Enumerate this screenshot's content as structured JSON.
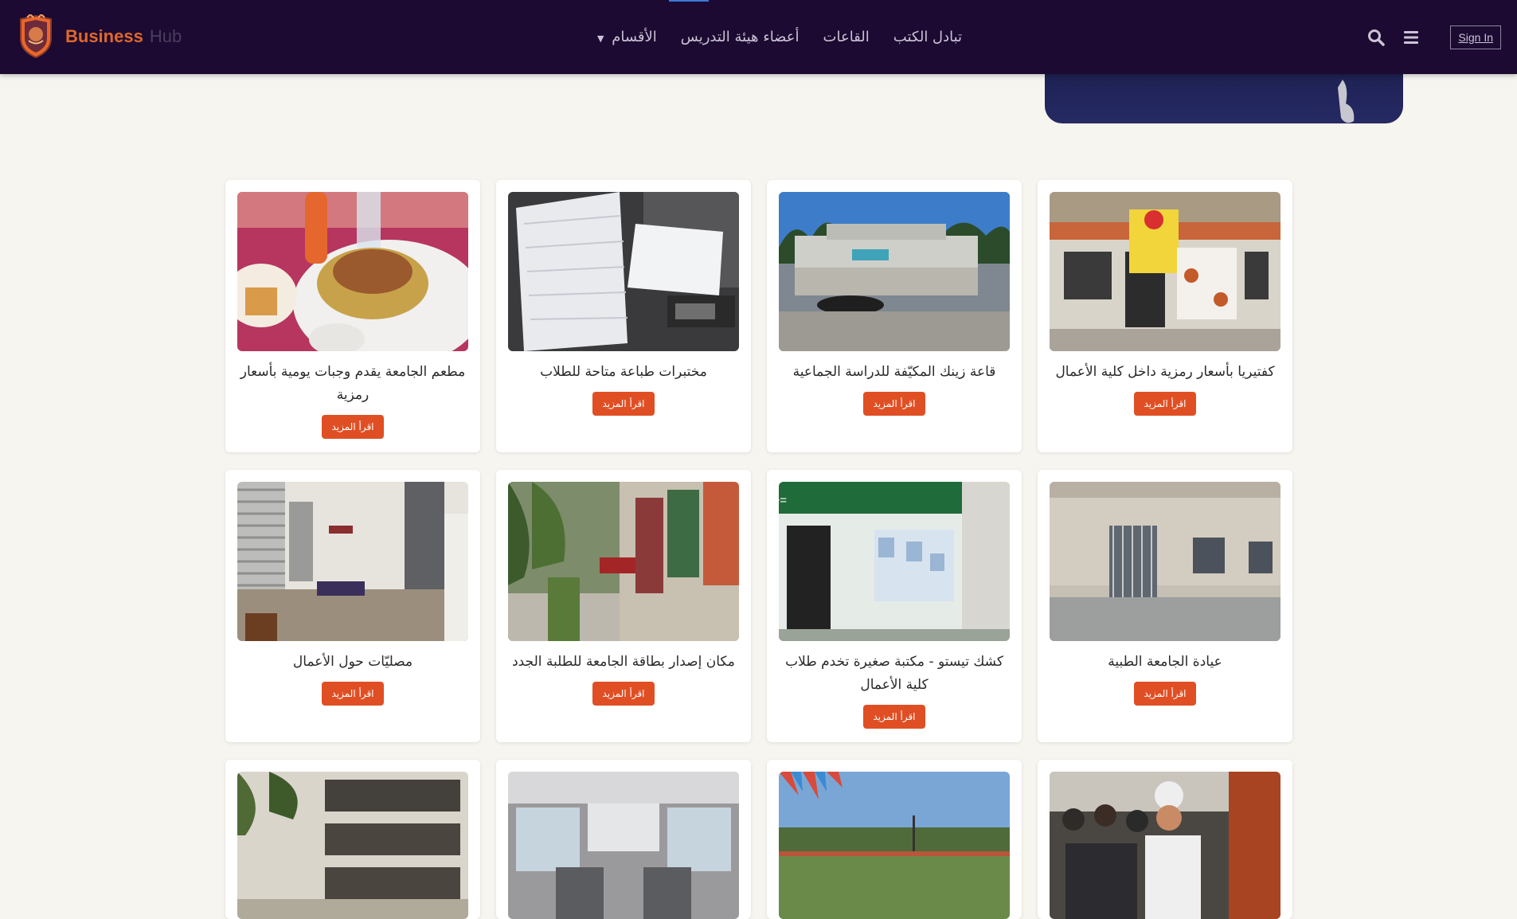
{
  "brand": {
    "business": "Business",
    "hub": "Hub"
  },
  "nav": {
    "items": [
      {
        "label": "الأقسام",
        "has_dropdown": true
      },
      {
        "label": "أعضاء هيئة التدريس"
      },
      {
        "label": "القاعات"
      },
      {
        "label": "تبادل الكتب"
      }
    ],
    "sign_in": "Sign In"
  },
  "cards": [
    {
      "title": "كفتيريا بأسعار رمزية داخل كلية الأعمال",
      "button": "اقرأ المزيد",
      "image": "cafeteria-storefront"
    },
    {
      "title": "قاعة زينك المكيّفة للدراسة الجماعية",
      "button": "اقرأ المزيد",
      "image": "zinc-building"
    },
    {
      "title": "مختبرات طباعة متاحة للطلاب",
      "button": "اقرأ المزيد",
      "image": "paper-stacks"
    },
    {
      "title": "مطعم الجامعة يقدم وجبات يومية بأسعار رمزية",
      "button": "اقرأ المزيد",
      "image": "chicken-meal"
    },
    {
      "title": "عيادة الجامعة الطبية",
      "button": "اقرأ المزيد",
      "image": "clinic-building"
    },
    {
      "title": "كشك تيستو - مكتبة صغيرة تخدم طلاب كلية الأعمال",
      "button": "اقرأ المزيد",
      "image": "kiosk",
      "kiosk_sign": "=UJ PRINTS Stationery&More"
    },
    {
      "title": "مكان إصدار بطاقة الجامعة للطلبة الجدد",
      "button": "اقرأ المزيد",
      "image": "campus-path"
    },
    {
      "title": "مصليّات حول الأعمال",
      "button": "اقرأ المزيد",
      "image": "prayer-room"
    },
    {
      "image": "crowd-chefs"
    },
    {
      "image": "stadium"
    },
    {
      "image": "bus-interior"
    },
    {
      "image": "building-trees"
    }
  ],
  "colors": {
    "navbar": "#1c0a32",
    "accent": "#e04f24",
    "brand": "#e0682c",
    "page_bg": "#f7f5f0"
  }
}
